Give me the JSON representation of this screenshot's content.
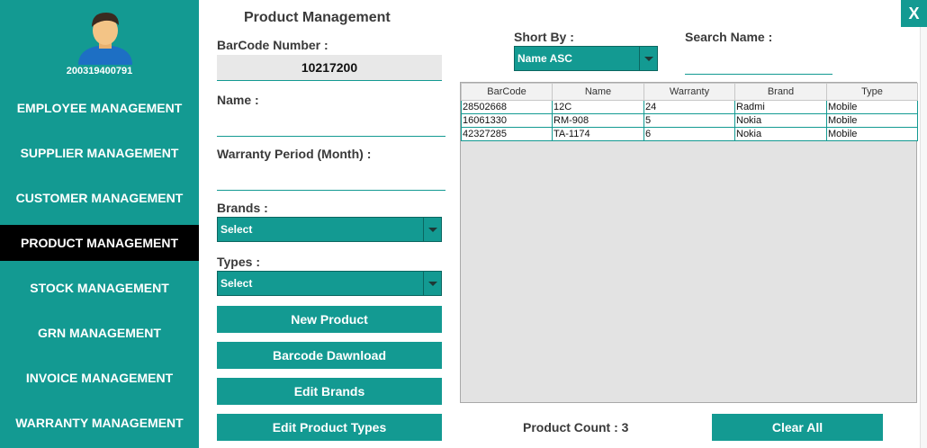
{
  "sidebar": {
    "user_id": "200319400791",
    "items": [
      {
        "label": "EMPLOYEE MANAGEMENT",
        "active": false
      },
      {
        "label": "SUPPLIER MANAGEMENT",
        "active": false
      },
      {
        "label": "CUSTOMER MANAGEMENT",
        "active": false
      },
      {
        "label": "PRODUCT MANAGEMENT",
        "active": true
      },
      {
        "label": "STOCK MANAGEMENT",
        "active": false
      },
      {
        "label": "GRN MANAGEMENT",
        "active": false
      },
      {
        "label": "INVOICE MANAGEMENT",
        "active": false
      },
      {
        "label": "WARRANTY MANAGEMENT",
        "active": false
      }
    ]
  },
  "window": {
    "close_label": "X"
  },
  "form": {
    "title": "Product Management",
    "barcode_label": "BarCode Number :",
    "barcode_value": "10217200",
    "name_label": "Name :",
    "name_value": "",
    "warranty_label": "Warranty Period (Month) :",
    "warranty_value": "",
    "brands_label": "Brands :",
    "brands_selected": "Select",
    "types_label": "Types :",
    "types_selected": "Select",
    "buttons": {
      "new_product": "New Product",
      "barcode_download": "Barcode Dawnload",
      "edit_brands": "Edit Brands",
      "edit_product_types": "Edit Product Types"
    }
  },
  "list": {
    "sort_label": "Short By  :",
    "sort_selected": "Name ASC",
    "search_label": "Search Name :",
    "search_value": "",
    "columns": [
      "BarCode",
      "Name",
      "Warranty",
      "Brand",
      "Type"
    ],
    "rows": [
      [
        "28502668",
        "12C",
        "24",
        "Radmi",
        "Mobile"
      ],
      [
        "16061330",
        "RM-908",
        "5",
        "Nokia",
        "Mobile"
      ],
      [
        "42327285",
        "TA-1174",
        "6",
        "Nokia",
        "Mobile"
      ]
    ],
    "count_label": "Product Count  :",
    "count_value": "3",
    "clear_all": "Clear All"
  },
  "colors": {
    "accent": "#139a92",
    "active_nav": "#000000",
    "text": "#3a3a3a"
  },
  "icons": [
    "user-avatar-icon",
    "close-icon",
    "dropdown-arrow-icon"
  ]
}
